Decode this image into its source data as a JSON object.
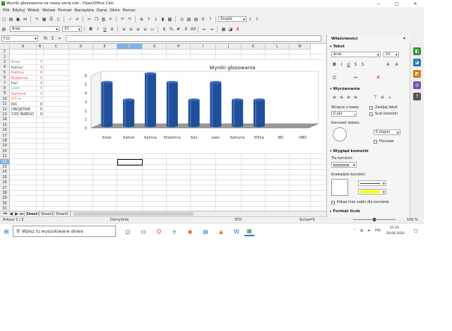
{
  "window": {
    "title": "Wyniki głosowania na nową serię.ods - OpenOffice Calc",
    "minimize": "−",
    "maximize": "□",
    "close": "✕"
  },
  "menu": [
    "Plik",
    "Edytuj",
    "Widok",
    "Wstaw",
    "Format",
    "Narzędzia",
    "Dane",
    "Okno",
    "Pomoc"
  ],
  "toolbar": {
    "style": "Znajdź",
    "font": "Arial",
    "size": "10"
  },
  "formula": {
    "namebox": "F22",
    "fx": "fx",
    "sum": "Σ",
    "eq": "="
  },
  "columns": [
    "A",
    "B",
    "C",
    "D",
    "E",
    "F",
    "G",
    "H",
    "I",
    "J",
    "K",
    "L",
    "M"
  ],
  "selected_column": "F",
  "rows": [
    "1",
    "2",
    "3",
    "4",
    "5",
    "6",
    "7",
    "8",
    "9",
    "10",
    "11",
    "12",
    "13",
    "14",
    "15",
    "16",
    "17",
    "18",
    "19",
    "20",
    "21",
    "22",
    "23",
    "24",
    "25",
    "26",
    "27",
    "28",
    "29",
    "30",
    "31"
  ],
  "selected_row": "22",
  "data_rows": [
    {
      "name": "Knee",
      "value": "5",
      "color": "#49a6e8"
    },
    {
      "name": "Katnel",
      "value": "3",
      "color": "#555555"
    },
    {
      "name": "Katnna",
      "value": "6",
      "color": "#e4545a"
    },
    {
      "name": "Ekaterina",
      "value": "5",
      "color": "#e4545a"
    },
    {
      "name": "Kaii",
      "value": "3",
      "color": "#555555"
    },
    {
      "name": "Leen",
      "value": "5",
      "color": "#49a6e8"
    },
    {
      "name": "Katnyne",
      "value": "3",
      "color": "#e4545a"
    },
    {
      "name": "ElEna",
      "value": "3",
      "color": "#f29a4c"
    },
    {
      "name": "NIC",
      "value": "0",
      "color": "#333333"
    },
    {
      "name": "OBOJĘTNIE",
      "value": "0",
      "color": "#333333"
    },
    {
      "name": "COŚ INNEGO",
      "value": "0",
      "color": "#333333"
    }
  ],
  "chart_data": {
    "type": "bar",
    "title": "Wyniki głosowania",
    "categories": [
      "Knee",
      "Katnel",
      "Katnna",
      "Ekaterina",
      "Kaii",
      "Leen",
      "Katnyne",
      "ElEna",
      "NIC",
      "OBO"
    ],
    "values": [
      5,
      3,
      6,
      5,
      3,
      5,
      3,
      3,
      0,
      0
    ],
    "ylim": [
      0,
      6
    ],
    "yticks": [
      "0",
      "1",
      "2",
      "3",
      "4",
      "5",
      "6"
    ],
    "bar_color": "#1f4e9a",
    "grid": false,
    "legend": "none"
  },
  "sheet_tabs": [
    "Sheet1",
    "Sheet2",
    "Sheet3"
  ],
  "active_tab": "Sheet1",
  "status": {
    "sheet": "Arkusz 1 / 3",
    "style": "Domyślnie",
    "mode": "STD",
    "sum": "Suma=0",
    "zoom": "100 %"
  },
  "sidebar": {
    "title": "Właściwości",
    "text_section": "Tekst",
    "font": "Arial",
    "size": "10",
    "align_section": "Wyrównanie",
    "indent_label": "Wcięcie z lewej:",
    "indent_value": "0 pkt",
    "wrap": "Zawijaj tekst",
    "merge": "Scal komórki",
    "direction_label": "Kierunek tekstu:",
    "direction_value": "0 stopni",
    "vertical": "Pionowo",
    "cell_section": "Wygląd komórki",
    "bg_label": "Tło komórki:",
    "border_label": "Krawędzie komórki:",
    "gridlines": "Pokaż linie siatki dla komórek",
    "number_section": "Format liczb"
  },
  "taskbar": {
    "search_placeholder": "Wpisz tu wyszukiwane słowa",
    "lang": "POL",
    "time": "21:10",
    "date": "28.08.2020"
  }
}
